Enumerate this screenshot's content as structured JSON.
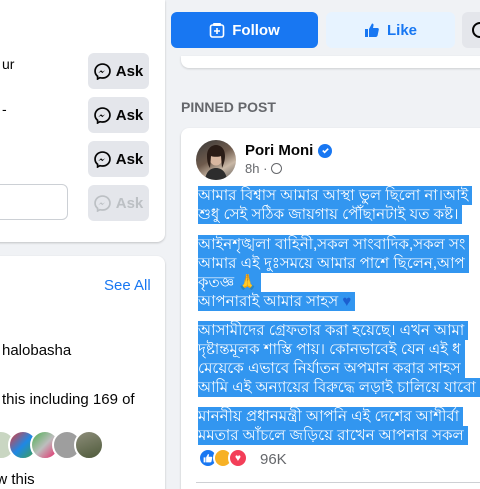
{
  "header": {
    "follow_label": "Follow",
    "like_label": "Like"
  },
  "left_panel": {
    "fragments": [
      "ur",
      "-"
    ],
    "ask_label": "Ask",
    "see_all": "See All",
    "name_fragment": "halobasha",
    "likes_fragment": "this including 169 of",
    "follows_fragment": "ow this"
  },
  "pinned": {
    "label": "PINNED POST",
    "author": "Pori Moni",
    "time": "8h ·",
    "lines": [
      "আমার বিশ্বাস আমার আস্থা ভুল ছিলো না।আই",
      "শুধু সেই সঠিক জায়গায় পৌঁছানটাই যত কষ্ট।",
      "আইনশৃঙ্খলা বাহিনী,সকল সাংবাদিক,সকল সং",
      "আমার এই দুঃসময়ে আমার পাশে ছিলেন,আপ",
      "কৃতজ্ঞ",
      "আপনারাই আমার সাহস",
      "আসামীদের গ্রেফতার করা হয়েছে। এখন আমা",
      "দৃষ্টান্তমূলক শাস্তি পায়। কোনভাবেই যেন এই ধ",
      "মেয়েকে এভাবে নির্যাতন অপমান করার সাহস",
      "আমি এই অন্যায়ের বিরুদ্ধে লড়াই চালিয়ে যাবো",
      "মাননীয় প্রধানমন্ত্রী আপনি এই দেশের আশীর্বা",
      "মমতার আঁচলে জড়িয়ে রাখেন আপনার সকল"
    ],
    "reaction_count": "96K"
  },
  "colors": {
    "accent": "#1877f2",
    "selection": "#3296f0",
    "like_bg": "#e7f3ff"
  }
}
